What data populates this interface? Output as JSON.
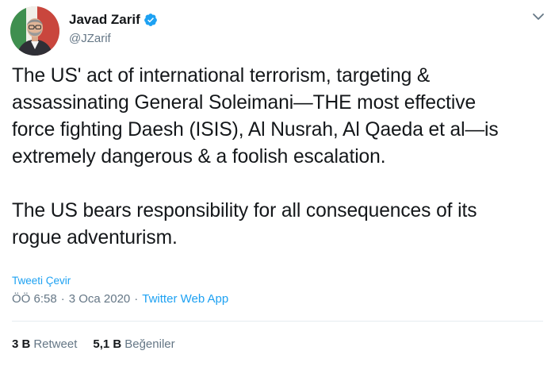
{
  "author": {
    "display_name": "Javad Zarif",
    "handle": "@JZarif",
    "verified": true,
    "avatar_icon": "profile-photo"
  },
  "tweet": {
    "paragraphs": [
      "The US' act of international terrorism, targeting &\nassassinating General Soleimani—THE most effective\nforce fighting Daesh (ISIS), Al Nusrah, Al Qaeda et al—is\nextremely dangerous & a foolish escalation.",
      "The US bears responsibility for all consequences of its\nrogue adventurism."
    ],
    "translate_label": "Tweeti Çevir",
    "time": "ÖÖ 6:58",
    "date": "3 Oca 2020",
    "separator": "·",
    "source_app": "Twitter Web App"
  },
  "stats": {
    "retweets_count": "3 B",
    "retweets_label": "Retweet",
    "likes_count": "5,1 B",
    "likes_label": "Beğeniler"
  },
  "colors": {
    "link": "#1da1f2",
    "secondary_text": "#657786",
    "primary_text": "#14171a",
    "divider": "#e6ecf0"
  }
}
